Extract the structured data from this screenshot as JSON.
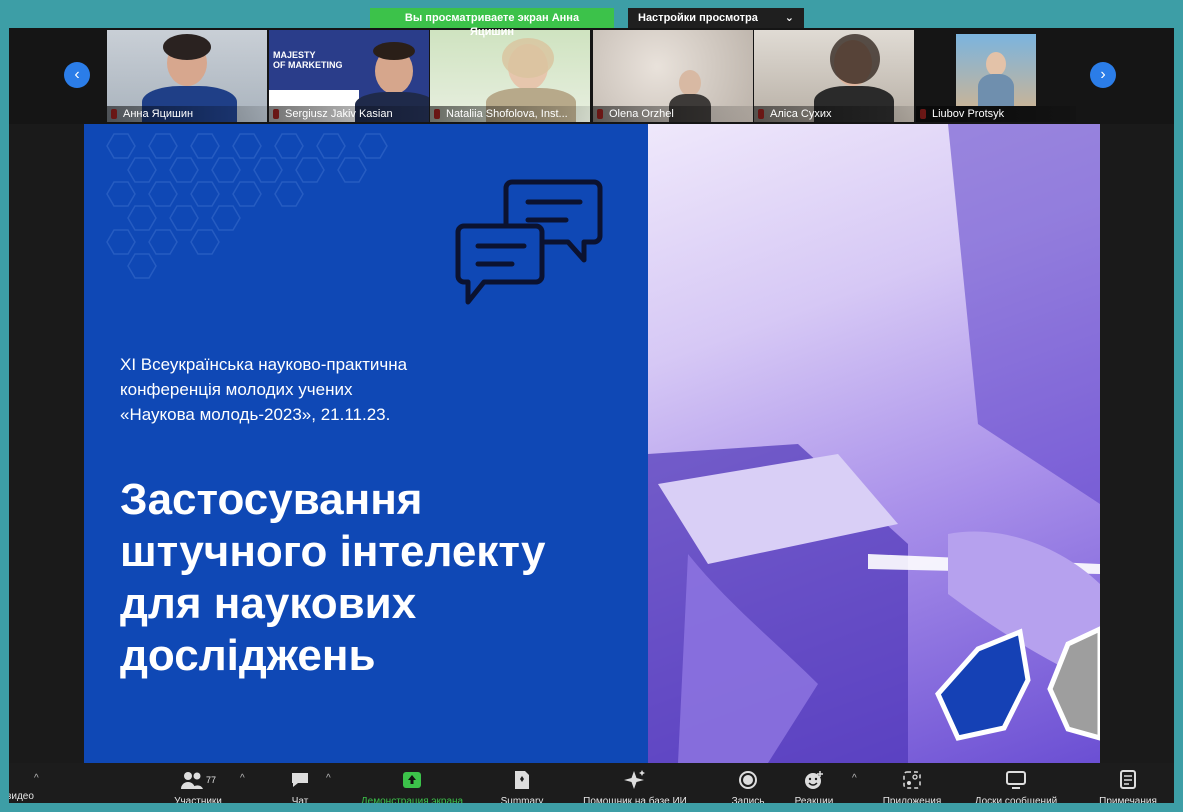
{
  "banner": {
    "share_text": "Вы просматриваете экран Анна Яцишин",
    "settings_label": "Настройки просмотра",
    "settings_chevron": "⌄"
  },
  "participants_strip": {
    "prev_icon": "chevron-left-icon",
    "next_icon": "chevron-right-icon",
    "tiles": [
      {
        "name": "Анна Яцишин"
      },
      {
        "name": "Sergiusz Jakiv Kasian"
      },
      {
        "name": "Nataliia Shofolova, Inst..."
      },
      {
        "name": "Olena Orzhel"
      },
      {
        "name": "Аліса Сухих"
      },
      {
        "name": "Liubov Protsyk"
      }
    ],
    "tile2_overlay": {
      "line1": "MAJESTY",
      "line2": "OF MARKETING"
    }
  },
  "slide": {
    "subtitle": [
      "XI Всеукраїнська науково-практична",
      "конференція молодих учених",
      "«Наукова молодь-2023», 21.11.23."
    ],
    "title": [
      "Застосування",
      "штучного інтелекту",
      "для наукових",
      "досліджень"
    ],
    "colors": {
      "left_bg": "#0f48b5",
      "accent": "#2b7de8"
    }
  },
  "toolbar": {
    "video_label": "видео",
    "participants_label": "Участники",
    "participants_count": "77",
    "chat_label": "Чат",
    "share_label": "Демонстрация экрана",
    "summary_label": "Summary",
    "ai_label": "Помощник на базе ИИ",
    "record_label": "Запись",
    "reactions_label": "Реакции",
    "apps_label": "Приложения",
    "whiteboards_label": "Доски сообщений",
    "notes_label": "Примечания",
    "caret": "^",
    "share_color": "#3cc24a"
  }
}
